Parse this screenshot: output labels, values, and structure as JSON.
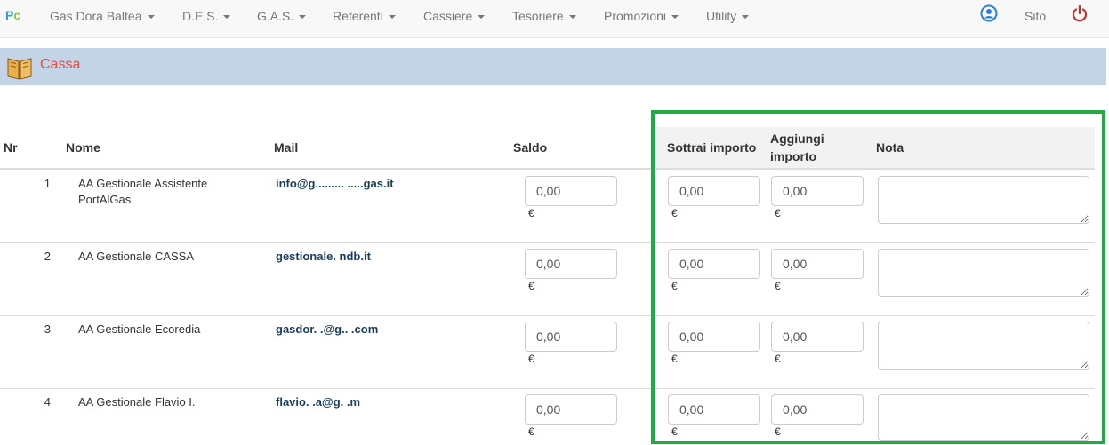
{
  "navbar": {
    "logo": {
      "p": "P",
      "c": "c"
    },
    "menus": [
      "Gas Dora Baltea",
      "D.E.S.",
      "G.A.S.",
      "Referenti",
      "Cassiere",
      "Tesoriere",
      "Promozioni",
      "Utility"
    ],
    "sito_label": "Sito",
    "colors": {
      "user_icon": "#2a7fd6",
      "power_icon": "#c9302c"
    }
  },
  "page": {
    "title": "Cassa",
    "title_color": "#e74c3c"
  },
  "table": {
    "headers": {
      "nr": "Nr",
      "nome": "Nome",
      "mail": "Mail",
      "saldo": "Saldo",
      "sottrai": "Sottrai importo",
      "aggiungi_1": "Aggiungi",
      "aggiungi_2": "importo",
      "nota": "Nota"
    },
    "currency": "€",
    "rows": [
      {
        "nr": "1",
        "name": "AA Gestionale Assistente PortAlGas",
        "mail": "info@g.........   .....gas.it",
        "saldo": "0,00",
        "sottrai": "0,00",
        "aggiungi": "0,00",
        "nota": ""
      },
      {
        "nr": "2",
        "name": "AA Gestionale CASSA",
        "mail": "gestionale.           ndb.it",
        "saldo": "0,00",
        "sottrai": "0,00",
        "aggiungi": "0,00",
        "nota": ""
      },
      {
        "nr": "3",
        "name": "AA Gestionale Ecoredia",
        "mail": "gasdor.     .@g..   .com",
        "saldo": "0,00",
        "sottrai": "0,00",
        "aggiungi": "0,00",
        "nota": ""
      },
      {
        "nr": "4",
        "name": "AA Gestionale Flavio I.",
        "mail": "flavio.                  .a@g.         .m",
        "saldo": "0,00",
        "sottrai": "0,00",
        "aggiungi": "0,00",
        "nota": ""
      }
    ]
  },
  "highlight_color": "#22aa44"
}
